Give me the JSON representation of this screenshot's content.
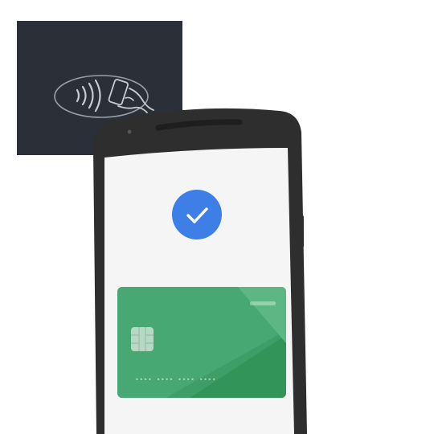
{
  "terminal": {
    "icon": "contactless-tap-icon",
    "background_color": "#2b2f37",
    "line_color": "#9aa0a6"
  },
  "phone": {
    "body_color": "#2e2e2e",
    "screen_color": "#f5f5f5"
  },
  "status": {
    "icon": "checkmark-icon",
    "color": "#3d7fe6"
  },
  "card": {
    "color": "#3f9e68",
    "number_mask": "•••• •••• •••• ••••"
  }
}
